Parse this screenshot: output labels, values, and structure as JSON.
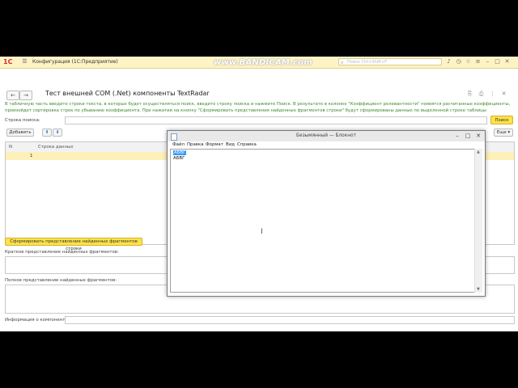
{
  "app": {
    "title": "Конфигурация (1С:Предприятие)",
    "logo": "1С",
    "watermark": "www.BANDICAM.com",
    "search_placeholder": "Поиск Ctrl+Shift+F"
  },
  "form": {
    "title": "Тест внешней COM (.Net) компоненты TextRadar",
    "info_text": "В табличную часть введите строки текста, в которых будет осуществляться поиск, введите строку поиска и нажмите Поиск. В результате в колонке \"Коэффициент релевантности\" появятся расчитанные коэффициенты, произойдет сортировка строк по убыванию коэффициента. При нажатии на кнопку \"Сформировать представления найденных фрагментов строки\" будут сформированы данные по выделенной строке таблицы",
    "search_label": "Строка поиска:",
    "search_value": "",
    "search_button": "Поиск",
    "add_button": "Добавить",
    "more_button": "Еще",
    "table": {
      "columns": [
        "N",
        "Строка данных"
      ],
      "rows": [
        {
          "n": "1",
          "text": ""
        }
      ]
    },
    "form_button": "Сформировать представление найденных фрагментов строки",
    "short_label": "Краткое представление найденных фрагментов:",
    "full_label": "Полное представление найденных фрагментов:",
    "component_label": "Информация о компоненте:"
  },
  "notepad": {
    "title": "Безымянный — Блокнот",
    "menu": [
      "Файл",
      "Правка",
      "Формат",
      "Вид",
      "Справка"
    ],
    "lines": [
      "АБВГ",
      "АБВГ"
    ]
  }
}
